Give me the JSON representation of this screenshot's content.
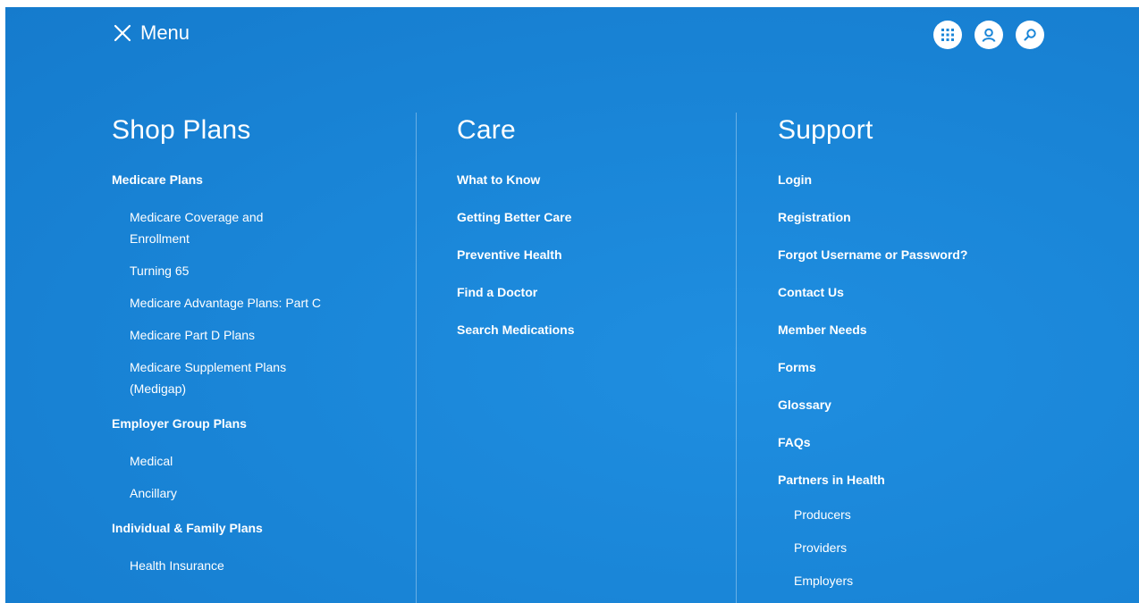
{
  "header": {
    "menu_label": "Menu",
    "close_icon": "close-icon",
    "icons": [
      "apps-grid-icon",
      "user-account-icon",
      "search-icon"
    ]
  },
  "colors": {
    "background": "#1a86d8",
    "text": "#ffffff"
  },
  "shop_plans": {
    "title": "Shop Plans",
    "medicare_plans": "Medicare Plans",
    "medicare_coverage": "Medicare Coverage and Enrollment",
    "turning_65": "Turning 65",
    "medicare_advantage": "Medicare Advantage Plans: Part C",
    "medicare_part_d": "Medicare Part D Plans",
    "medicare_supplement": "Medicare Supplement Plans (Medigap)",
    "employer_group": "Employer Group Plans",
    "medical": "Medical",
    "ancillary": "Ancillary",
    "individual_family": "Individual & Family Plans",
    "health_insurance": "Health Insurance"
  },
  "care": {
    "title": "Care",
    "items": [
      "What to Know",
      "Getting Better Care",
      "Preventive Health",
      "Find a Doctor",
      "Search Medications"
    ]
  },
  "support": {
    "title": "Support",
    "items": [
      "Login",
      "Registration",
      "Forgot Username or Password?",
      "Contact Us",
      "Member Needs",
      "Forms",
      "Glossary",
      "FAQs",
      "Partners in Health"
    ],
    "partners_sub": [
      "Producers",
      "Providers",
      "Employers"
    ]
  }
}
